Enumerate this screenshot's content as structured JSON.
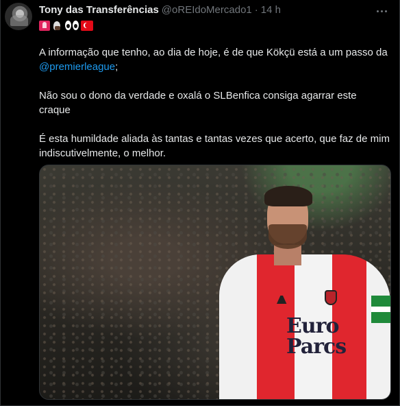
{
  "author": {
    "display_name": "Tony das Transferências",
    "handle": "@oREIdoMercado1",
    "separator": "·",
    "time": "14 h"
  },
  "bio_emojis": [
    "siren-flag-icon",
    "eagle-icon",
    "eyes-icon",
    "turkey-flag-icon"
  ],
  "tweet": {
    "p1_before": "A informação que tenho, ao dia de hoje, é de que Kökçü está a um passo da ",
    "p1_mention": "@premierleague",
    "p1_after": ";",
    "p2": "Não sou o dono da verdade e oxalá o SLBenfica consiga agarrar este craque",
    "p3": "É esta humildade aliada às tantas e tantas vezes que acerto, que faz de mim indiscutivelmente, o melhor."
  },
  "media": {
    "sponsor_text": "Euro\nParcs"
  },
  "colors": {
    "background": "#000000",
    "text": "#e7e9ea",
    "muted": "#71767b",
    "link": "#1d9bf0"
  }
}
